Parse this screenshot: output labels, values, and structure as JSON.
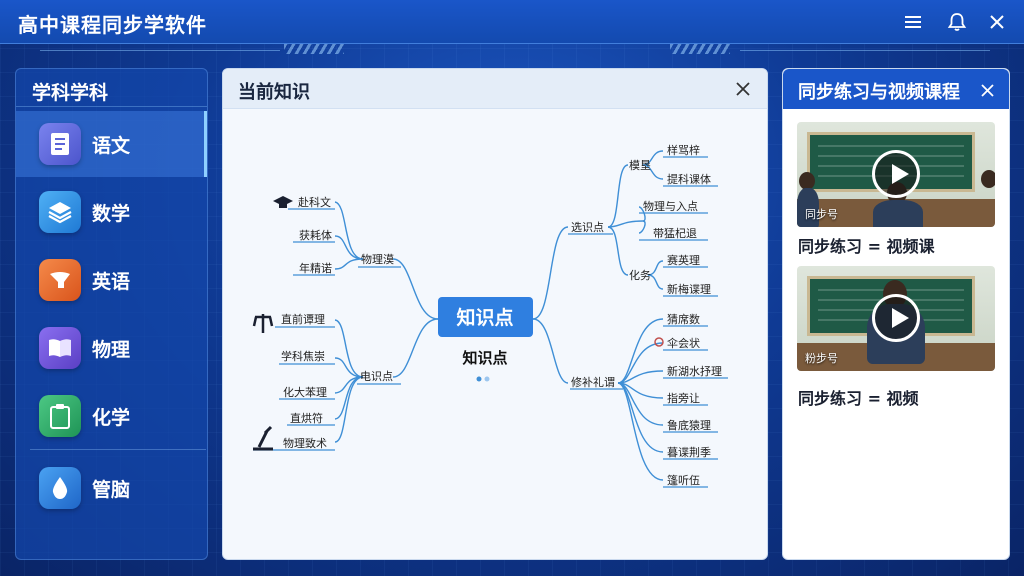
{
  "app": {
    "title": "高中课程同步学软件"
  },
  "sidebar": {
    "header": "学科学科",
    "items": [
      {
        "label": "语文",
        "icon": "notebook-icon",
        "color": "#5b64d8"
      },
      {
        "label": "数学",
        "icon": "layers-icon",
        "color": "#2f8fe0"
      },
      {
        "label": "英语",
        "icon": "megaphone-icon",
        "color": "#e86a2e"
      },
      {
        "label": "物理",
        "icon": "open-book-icon",
        "color": "#6a4fd0"
      },
      {
        "label": "化学",
        "icon": "clipboard-icon",
        "color": "#2fa866"
      },
      {
        "label": "管脑",
        "icon": "water-drop-icon",
        "color": "#2677d8"
      }
    ]
  },
  "knowledge": {
    "header": "当前知识",
    "center_node": "知识点",
    "center_caption": "知识点",
    "left_branches": [
      {
        "label": "物理漠",
        "leaves": [
          "赴科文",
          "获耗体",
          "年精诺"
        ]
      },
      {
        "label": "电识点",
        "leaves": [
          "直前谭理",
          "学科焦崇",
          "化大苯理",
          "直烘符",
          "物理致术"
        ]
      }
    ],
    "right_branches": [
      {
        "label": "选识点",
        "groups": [
          {
            "label": "模垦",
            "leaves": [
              "样骂梓",
              "提科课体"
            ]
          },
          {
            "label": "",
            "leaves": [
              "物理与入点",
              "带猛杞退"
            ]
          },
          {
            "label": "化务",
            "leaves": [
              "赛英理",
              "新梅谍理"
            ]
          }
        ]
      },
      {
        "label": "修补礼谓",
        "leaves": [
          "猜席数",
          "伞会状",
          "新湖水抒理",
          "指旁让",
          "鲁底猿理",
          "暮谍荆季",
          "篷听伍"
        ]
      }
    ]
  },
  "practice": {
    "header": "同步练习与视频课程",
    "videos": [
      {
        "tag": "同步号",
        "caption": "同步练习 = 视频课"
      },
      {
        "tag": "粉步号",
        "caption": "同步练习 = 视频"
      }
    ]
  },
  "colors": {
    "accent": "#1a56c9",
    "branch": "#3f8fd6",
    "center_node": "#2f7fe0"
  }
}
